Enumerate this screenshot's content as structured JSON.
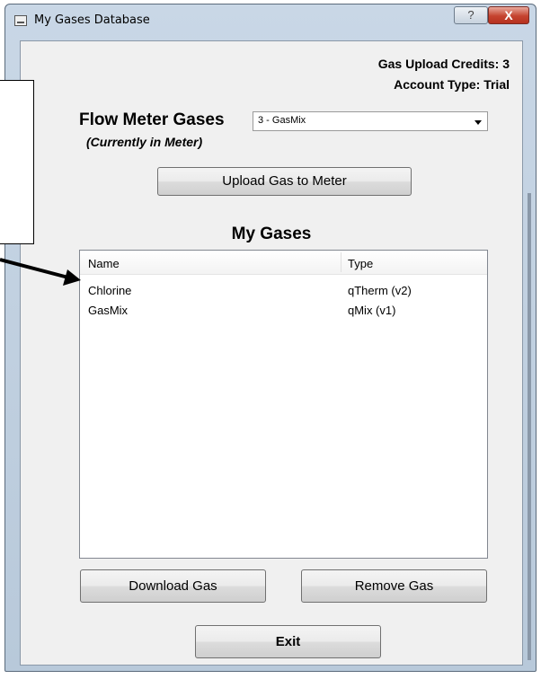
{
  "window": {
    "title": "My Gases Database",
    "help_glyph": "?",
    "close_glyph": "X"
  },
  "account": {
    "credits_text": "Gas Upload Credits: 3",
    "type_text": "Account Type: Trial"
  },
  "flow_meter": {
    "label": "Flow Meter Gases",
    "sublabel": "(Currently in Meter)",
    "selected": "3 - GasMix"
  },
  "buttons": {
    "upload": "Upload Gas to Meter",
    "download": "Download Gas",
    "remove": "Remove Gas",
    "exit": "Exit"
  },
  "my_gases": {
    "title": "My Gases",
    "columns": [
      "Name",
      "Type"
    ],
    "rows": [
      {
        "name": "Chlorine",
        "type": "qTherm (v2)"
      },
      {
        "name": "GasMix",
        "type": "qMix (v1)"
      }
    ]
  }
}
